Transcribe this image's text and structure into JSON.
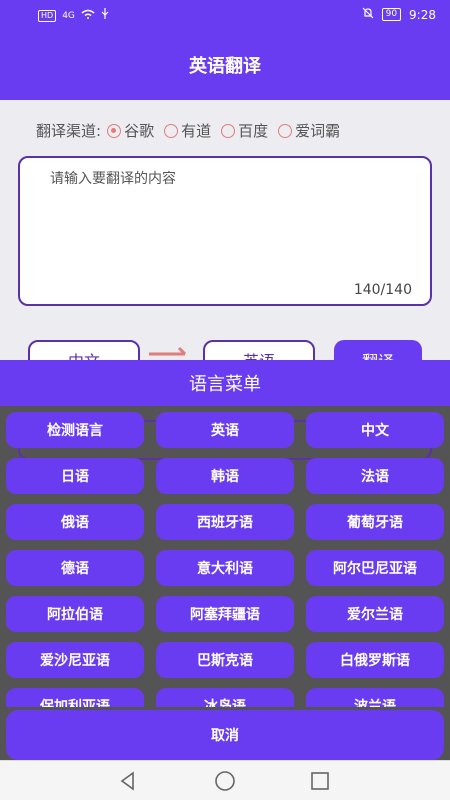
{
  "status": {
    "left_chip": "HD",
    "signal": "4G",
    "battery": "90",
    "time": "9:28"
  },
  "app": {
    "title": "英语翻译"
  },
  "channel": {
    "label": "翻译渠道:",
    "options": [
      "谷歌",
      "有道",
      "百度",
      "爱词霸"
    ],
    "selected": "谷歌"
  },
  "input": {
    "placeholder": "请输入要翻译的内容",
    "counter": "140/140"
  },
  "buttons": {
    "source": "中文",
    "target": "英语",
    "translate": "翻译"
  },
  "menu": {
    "title": "语言菜单",
    "items": [
      "检测语言",
      "英语",
      "中文",
      "日语",
      "韩语",
      "法语",
      "俄语",
      "西班牙语",
      "葡萄牙语",
      "德语",
      "意大利语",
      "阿尔巴尼亚语",
      "阿拉伯语",
      "阿塞拜疆语",
      "爱尔兰语",
      "爱沙尼亚语",
      "巴斯克语",
      "白俄罗斯语",
      "保加利亚语",
      "冰岛语",
      "波兰语"
    ],
    "cancel": "取消"
  },
  "colors": {
    "primary": "#6a3cf1",
    "accent": "#5a31a8",
    "radio": "#e07d7d"
  }
}
